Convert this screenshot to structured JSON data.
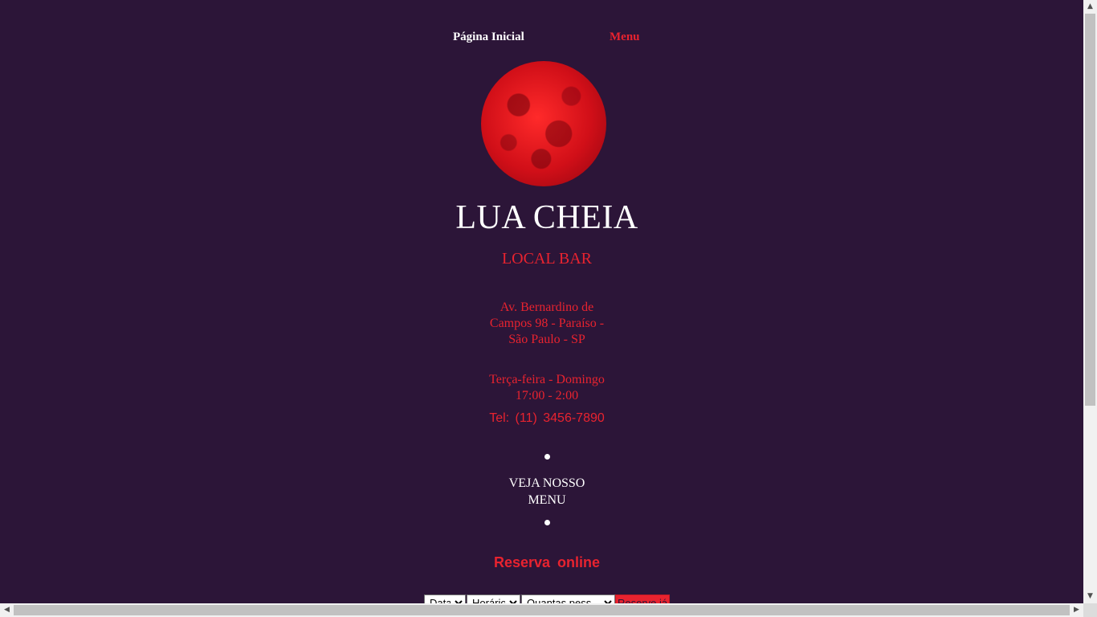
{
  "nav": {
    "home_label": "Página Inicial",
    "menu_label": "Menu"
  },
  "brand": {
    "name": "LUA CHEIA",
    "subtitle": "LOCAL BAR",
    "logo_icon": "red-moon-icon"
  },
  "info": {
    "address": "Av. Bernardino de Campos 98 - Paraíso - São Paulo - SP",
    "days": "Terça-feira - Domingo",
    "hours": "17:00 - 2:00",
    "phone": "Tel: (11) 3456-7890"
  },
  "menu_link": {
    "label": "VEJA NOSSO MENU"
  },
  "reservation": {
    "title": "Reserva online",
    "date_selected": "Data",
    "time_selected": "Horário",
    "people_selected": "Quantas pess",
    "submit_label": "Reserve já"
  },
  "colors": {
    "background": "#2c1538",
    "accent": "#e8232f",
    "text_light": "#ffffff"
  }
}
